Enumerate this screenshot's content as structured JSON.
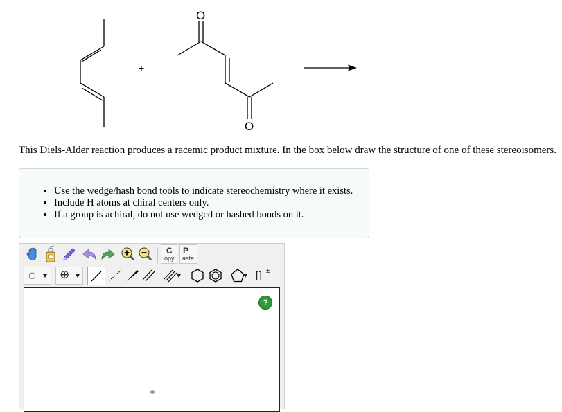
{
  "scheme": {
    "plus": "+",
    "atom_o": "O"
  },
  "question": "This Diels-Alder reaction produces a racemic product mixture. In the box below draw the structure of one of these stereoisomers.",
  "instructions": [
    "Use the wedge/hash bond tools to indicate stereochemistry where it exists.",
    "Include H atoms at chiral centers only.",
    "If a group is achiral, do not use wedged or hashed bonds on it."
  ],
  "toolbar": {
    "copy_top": "C",
    "copy_bottom": "opy",
    "paste_top": "P",
    "paste_bottom": "aste",
    "element": "C",
    "charge_symbol": "⊕",
    "bracket_label": "[]",
    "bracket_sup": "±",
    "help": "?"
  },
  "colors": {
    "instruction_bg": "#f6faf8",
    "help_green": "#2e9a3a",
    "pencil_purple": "#8a5cf0",
    "undo_purple": "#a98ee0",
    "redo_green": "#4caa5a"
  }
}
